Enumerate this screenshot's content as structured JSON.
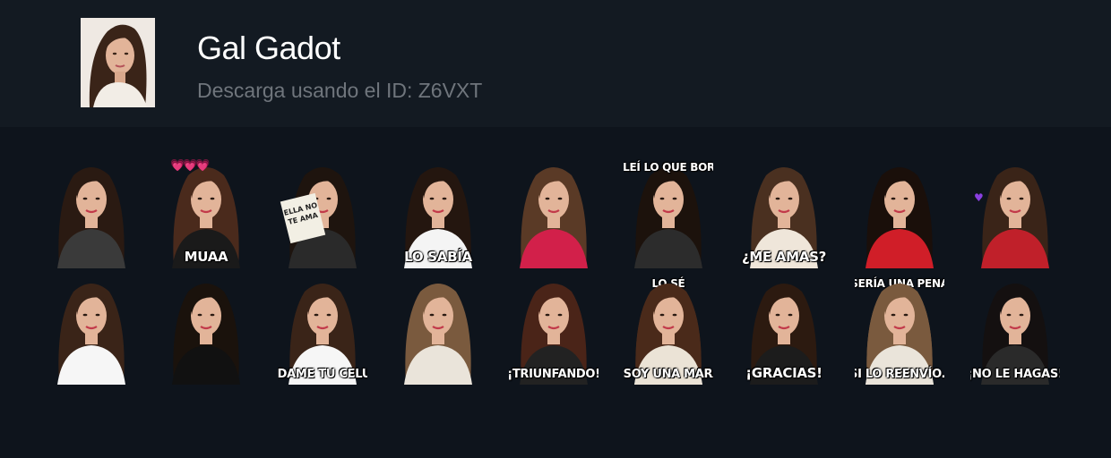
{
  "profile": {
    "name": "Gal Gadot",
    "download_text": "Descarga usando el ID: Z6VXT"
  },
  "stickers": [
    {
      "caption": "",
      "caption_pos": "none",
      "hair": "#2a1a12",
      "outfit": "#3a3a3a"
    },
    {
      "caption": "MUAA",
      "caption_pos": "bottom",
      "hair": "#4a2a1c",
      "outfit": "#1a1a1a"
    },
    {
      "caption": "ELLA NO TE AMA",
      "caption_pos": "sign",
      "hair": "#1e140e",
      "outfit": "#2a2a2a"
    },
    {
      "caption": "LO SABÍA",
      "caption_pos": "bottom",
      "hair": "#24160f",
      "outfit": "#f4f4f4"
    },
    {
      "caption": "",
      "caption_pos": "none",
      "hair": "#5a3a26",
      "outfit": "#d2204a"
    },
    {
      "caption": "¡LEÍ LO QUE BORRASTE!",
      "caption_pos": "top",
      "hair": "#1c120c",
      "outfit": "#2c2c2c"
    },
    {
      "caption": "¿ME AMAS?",
      "caption_pos": "bottom",
      "hair": "#4a3020",
      "outfit": "#efe6da"
    },
    {
      "caption": "",
      "caption_pos": "none",
      "hair": "#1a0f0a",
      "outfit": "#d01e28"
    },
    {
      "caption": "",
      "caption_pos": "none",
      "hair": "#3a2418",
      "outfit": "#c0202a"
    },
    {
      "caption": "",
      "caption_pos": "none",
      "hair": "#3a2418",
      "outfit": "#f6f6f6"
    },
    {
      "caption": "",
      "caption_pos": "none",
      "hair": "#1a120c",
      "outfit": "#111111"
    },
    {
      "caption": "¡DAME TU CELULAR!",
      "caption_pos": "bottom",
      "hair": "#3a2418",
      "outfit": "#f6f6f6"
    },
    {
      "caption": "",
      "caption_pos": "none",
      "hair": "#7a5a3e",
      "outfit": "#eae4da"
    },
    {
      "caption": "¡TRIUNFANDO!",
      "caption_pos": "bottom",
      "hair": "#4a2418",
      "outfit": "#222222"
    },
    {
      "caption": "LO SÉ",
      "caption_pos": "top",
      "hair": "#4a2a1a",
      "outfit": "#ebe3d6"
    },
    {
      "caption": "¡SOY UNA MARAVILLA!",
      "caption_pos": "bottom",
      "hair": "#4a2a1a",
      "outfit": "#ebe3d6"
    },
    {
      "caption": "¡GRACIAS!",
      "caption_pos": "bottom",
      "hair": "#2c1a10",
      "outfit": "#1c1c1c"
    },
    {
      "caption": "SERÍA UNA PENA",
      "caption_pos": "top",
      "hair": "#7a5a3e",
      "outfit": "#eae4da"
    },
    {
      "caption": "SI LO REENVÍO...",
      "caption_pos": "bottom",
      "hair": "#7a5a3e",
      "outfit": "#eae4da"
    },
    {
      "caption": "¡NO LE HAGAS!",
      "caption_pos": "bottom",
      "hair": "#141010",
      "outfit": "#2a2a2a"
    }
  ],
  "hearts_text": "💗💗💗",
  "colors": {
    "background": "#0e141c",
    "header": "#131a22",
    "title": "#ffffff",
    "subtitle": "#6f757c",
    "skin": "#e2b499"
  }
}
